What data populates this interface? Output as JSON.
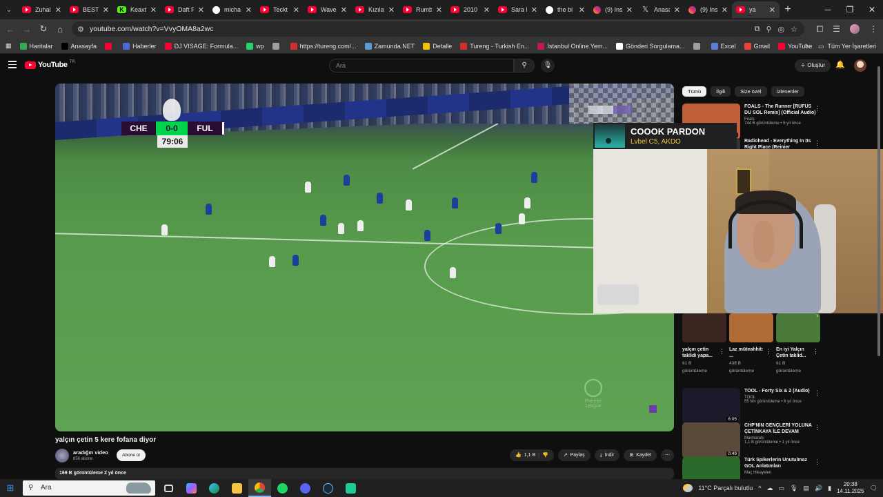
{
  "browser": {
    "tabs": [
      {
        "label": "Zuhal",
        "favicon": "youtube"
      },
      {
        "label": "BEST (",
        "favicon": "youtube"
      },
      {
        "label": "Keaxt",
        "favicon": "kick"
      },
      {
        "label": "Daft P",
        "favicon": "youtube"
      },
      {
        "label": "micha",
        "favicon": "google"
      },
      {
        "label": "Teckt",
        "favicon": "youtube"
      },
      {
        "label": "Wave",
        "favicon": "youtube"
      },
      {
        "label": "Kızılay",
        "favicon": "youtube"
      },
      {
        "label": "Rumb",
        "favicon": "youtube"
      },
      {
        "label": "2010",
        "favicon": "youtube"
      },
      {
        "label": "Sara L",
        "favicon": "youtube"
      },
      {
        "label": "the bi",
        "favicon": "google"
      },
      {
        "label": "(9) Ins",
        "favicon": "instagram"
      },
      {
        "label": "Anasa",
        "favicon": "x"
      },
      {
        "label": "(9) Ins",
        "favicon": "instagram"
      },
      {
        "label": "ya",
        "favicon": "youtube"
      }
    ],
    "active_tab_index": 15,
    "url": "youtube.com/watch?v=VvyOMA8a2wc",
    "bookmarks": [
      {
        "label": "Haritalar",
        "color": "#34a853"
      },
      {
        "label": "Anasayfa",
        "color": "#000000"
      },
      {
        "label": "",
        "color": "#ff0033"
      },
      {
        "label": "Haberler",
        "color": "#4a6cd4"
      },
      {
        "label": "DJ VISAGE: Formula...",
        "color": "#ff0033"
      },
      {
        "label": "wp",
        "color": "#25d366"
      },
      {
        "label": "",
        "color": "#9aa0a6"
      },
      {
        "label": "https://tureng.com/...",
        "color": "#d32f2f"
      },
      {
        "label": "Zamunda.NET",
        "color": "#5a9bd4"
      },
      {
        "label": "Detalle",
        "color": "#f2c200"
      },
      {
        "label": "Tureng - Turkish En...",
        "color": "#d32f2f"
      },
      {
        "label": "İstanbul Online Yem...",
        "color": "#c2185b"
      },
      {
        "label": "Gönderi Sorgulama...",
        "color": "#ffffff"
      },
      {
        "label": "",
        "color": "#9aa0a6"
      },
      {
        "label": "Excel",
        "color": "#5b7fd6"
      },
      {
        "label": "Gmail",
        "color": "#ea4335"
      },
      {
        "label": "YouTube",
        "color": "#ff0033"
      }
    ],
    "all_bookmarks_label": "Tüm Yer İşaretleri"
  },
  "youtube": {
    "logo_text": "YouTube",
    "logo_country": "TR",
    "search_placeholder": "Ara",
    "create_label": "Oluştur"
  },
  "video": {
    "title": "yalçın çetin 5 kere fofana diyor",
    "channel": "aradığın video",
    "subscribers": "856 abone",
    "subscribe_label": "Abone ol",
    "likes": "1,1 B",
    "share_label": "Paylaş",
    "download_label": "İndir",
    "save_label": "Kaydet",
    "views_date": "169 B görüntüleme  2 yıl önce",
    "score": {
      "home": "CHE",
      "score": "0-0",
      "away": "FUL",
      "clock": "79:06"
    },
    "watermark": "Premier League"
  },
  "overlay": {
    "song": "COOOK PARDON",
    "artist": "Lvbel C5, AKDO"
  },
  "sidebar": {
    "chips": [
      "Tümü",
      "İlgili",
      "Size özel",
      "İzlenenler"
    ],
    "active_chip": 0,
    "recs_top": [
      {
        "title": "FOALS - The Runner [RÜFÜS DU SOL Remix] (Official Audio)",
        "channel": "Foals",
        "meta": "744 B görüntüleme • 5 yıl önce",
        "duration": "3",
        "thumb_color": "#c0603a"
      },
      {
        "title": "Radiohead - Everything In Its Right Place (Reinier Zonneveld...",
        "channel": "",
        "meta": "",
        "duration": "",
        "thumb_color": "#333333"
      }
    ],
    "shorts": [
      {
        "title": "yalçın çetin taklidi yapa...",
        "meta1": "61 B",
        "meta2": "görüntüleme",
        "thumb_color": "#3a2520"
      },
      {
        "title": "Laz müteahhit: ...",
        "meta1": "438 B",
        "meta2": "görüntüleme",
        "thumb_color": "#b06a35"
      },
      {
        "title": "En iyi Yalçın Çetin taklid...",
        "meta1": "61 B",
        "meta2": "görüntüleme",
        "thumb_color": "#4a7a3a"
      }
    ],
    "recs_bottom": [
      {
        "title": "TOOL - Forty Six & 2 (Audio)",
        "channel": "TOOL",
        "meta": "55 Mn görüntüleme • 6 yıl önce",
        "duration": "6:05",
        "thumb_color": "#1a1a2a"
      },
      {
        "title": "CHP'NİN GENÇLERİ YOLUNA ÇETİNKAYA İLE DEVAM EDECEK",
        "channel": "Marmaratv",
        "meta": "1,1 B görüntüleme • 1 yıl önce",
        "duration": "0:49",
        "thumb_color": "#5a4a3a"
      },
      {
        "title": "Türk Spikerlerin Unutulmaz GOL Anlatımları",
        "channel": "Maç Hikayeleri",
        "meta": "",
        "duration": "",
        "thumb_color": "#2a6a2a"
      }
    ]
  },
  "taskbar": {
    "search_placeholder": "Ara",
    "weather": "11°C  Parçalı bulutlu",
    "time": "20:38",
    "date": "14.11.2025"
  }
}
